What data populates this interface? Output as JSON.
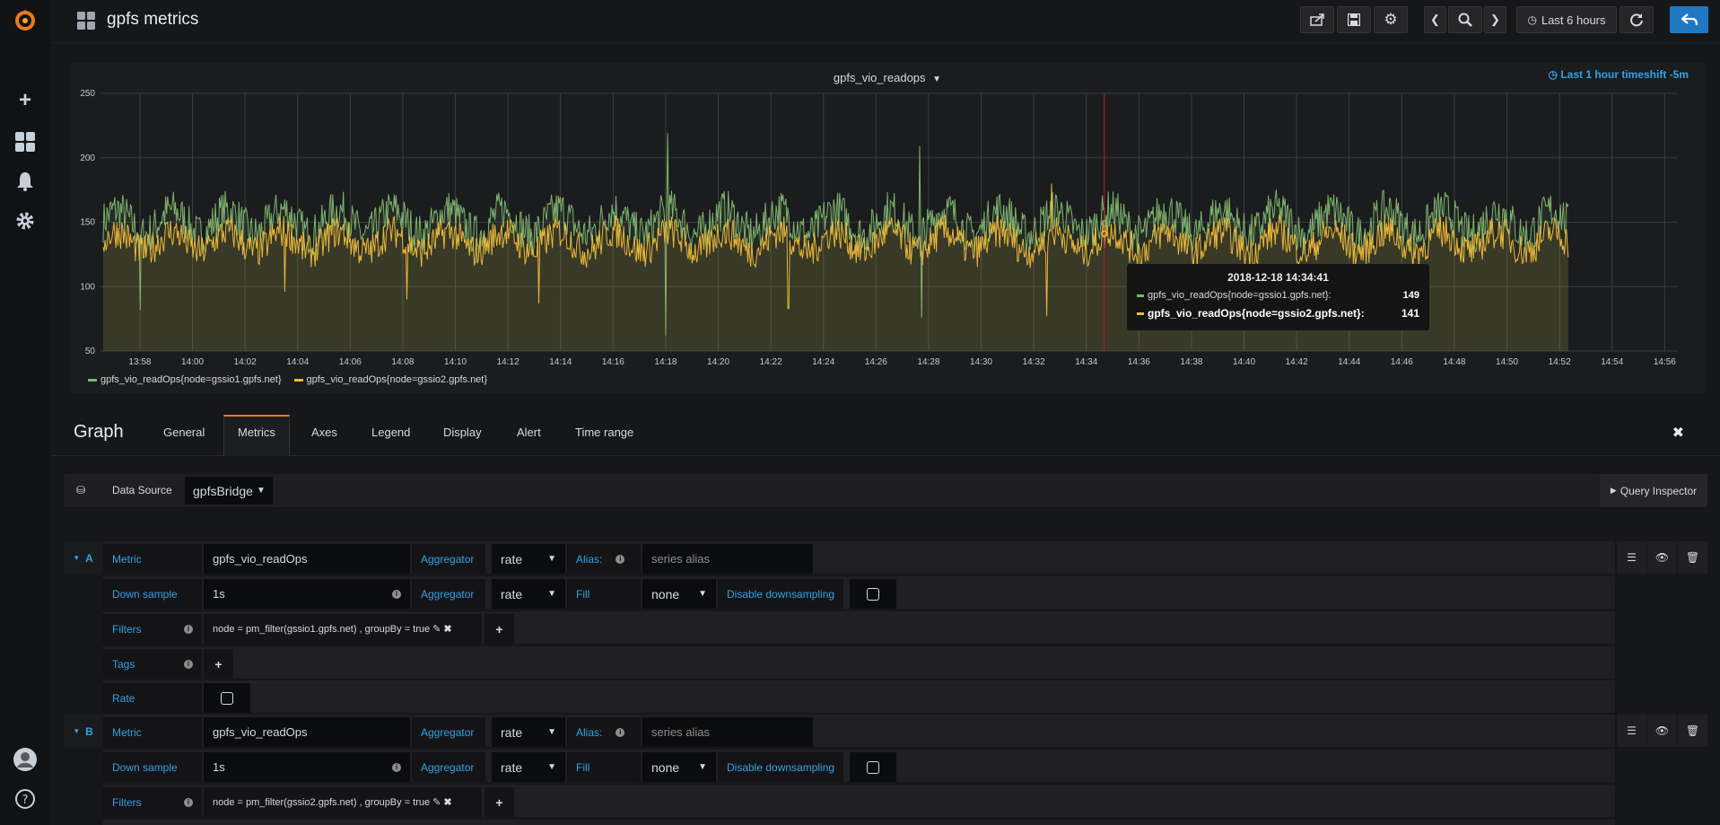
{
  "app": {
    "dashboard_title": "gpfs metrics",
    "time_range_label": "Last 6 hours"
  },
  "panel": {
    "title": "gpfs_vio_readops",
    "timeshift_info": "Last 1 hour timeshift -5m",
    "tooltip": {
      "time": "2018-12-18 14:34:41",
      "rows": [
        {
          "label": "gpfs_vio_readOps{node=gssio1.gpfs.net}:",
          "value": "149"
        },
        {
          "label": "gpfs_vio_readOps{node=gssio2.gpfs.net}:",
          "value": "141"
        }
      ]
    },
    "legend": [
      {
        "label": "gpfs_vio_readOps{node=gssio1.gpfs.net}"
      },
      {
        "label": "gpfs_vio_readOps{node=gssio2.gpfs.net}"
      }
    ]
  },
  "chart_data": {
    "type": "line",
    "title": "gpfs_vio_readops",
    "x_ticks": [
      "13:58",
      "14:00",
      "14:02",
      "14:04",
      "14:06",
      "14:08",
      "14:10",
      "14:12",
      "14:14",
      "14:16",
      "14:18",
      "14:20",
      "14:22",
      "14:24",
      "14:26",
      "14:28",
      "14:30",
      "14:32",
      "14:34",
      "14:36",
      "14:38",
      "14:40",
      "14:42",
      "14:44",
      "14:46",
      "14:48",
      "14:50",
      "14:52",
      "14:54",
      "14:56"
    ],
    "y_ticks": [
      50,
      100,
      150,
      200,
      250
    ],
    "ylim": [
      50,
      250
    ],
    "x_range": [
      "13:56:30",
      "14:56:30"
    ],
    "grid": true,
    "legend_position": "bottom-left",
    "cursor_time": "14:34:41",
    "series": [
      {
        "name": "gpfs_vio_readOps{node=gssio1.gpfs.net}",
        "color": "#7eb26d",
        "baseline": 150,
        "noise": 16,
        "ends_at": "14:52:20",
        "spikes": [
          [
            "13:58:00",
            82
          ],
          [
            "14:18:00",
            62
          ],
          [
            "14:18:05",
            219
          ],
          [
            "14:27:40",
            209
          ],
          [
            "14:27:45",
            76
          ]
        ]
      },
      {
        "name": "gpfs_vio_readOps{node=gssio2.gpfs.net}",
        "color": "#eab839",
        "baseline": 135,
        "noise": 13,
        "ends_at": "14:52:20",
        "spikes": [
          [
            "14:03:30",
            96
          ],
          [
            "14:08:10",
            90
          ],
          [
            "14:13:10",
            87
          ],
          [
            "14:22:40",
            83
          ],
          [
            "14:32:30",
            77
          ],
          [
            "14:32:40",
            180
          ]
        ]
      }
    ],
    "highlight_values": {
      "time": "2018-12-18 14:34:41",
      "series_values": [
        149,
        141
      ]
    }
  },
  "editor": {
    "title": "Graph",
    "tabs": [
      "General",
      "Metrics",
      "Axes",
      "Legend",
      "Display",
      "Alert",
      "Time range"
    ],
    "active_tab": "Metrics",
    "datasource_label": "Data Source",
    "datasource_value": "gpfsBridge",
    "query_inspector": "Query Inspector",
    "queries": [
      {
        "ref": "A",
        "metric_label": "Metric",
        "metric": "gpfs_vio_readOps",
        "aggregator_label": "Aggregator",
        "aggregator": "rate",
        "alias_label": "Alias:",
        "alias_placeholder": "series alias",
        "downsample_label": "Down sample",
        "downsample": "1s",
        "aggregator2": "rate",
        "fill_label": "Fill",
        "fill": "none",
        "disable_downsampling_label": "Disable downsampling",
        "filters_label": "Filters",
        "filter": "node = pm_filter(gssio1.gpfs.net) , groupBy = true",
        "tags_label": "Tags",
        "rate_label": "Rate"
      },
      {
        "ref": "B",
        "metric_label": "Metric",
        "metric": "gpfs_vio_readOps",
        "aggregator_label": "Aggregator",
        "aggregator": "rate",
        "alias_label": "Alias:",
        "alias_placeholder": "series alias",
        "downsample_label": "Down sample",
        "downsample": "1s",
        "aggregator2": "rate",
        "fill_label": "Fill",
        "fill": "none",
        "disable_downsampling_label": "Disable downsampling",
        "filters_label": "Filters",
        "filter": "node = pm_filter(gssio2.gpfs.net) , groupBy = true"
      }
    ]
  }
}
